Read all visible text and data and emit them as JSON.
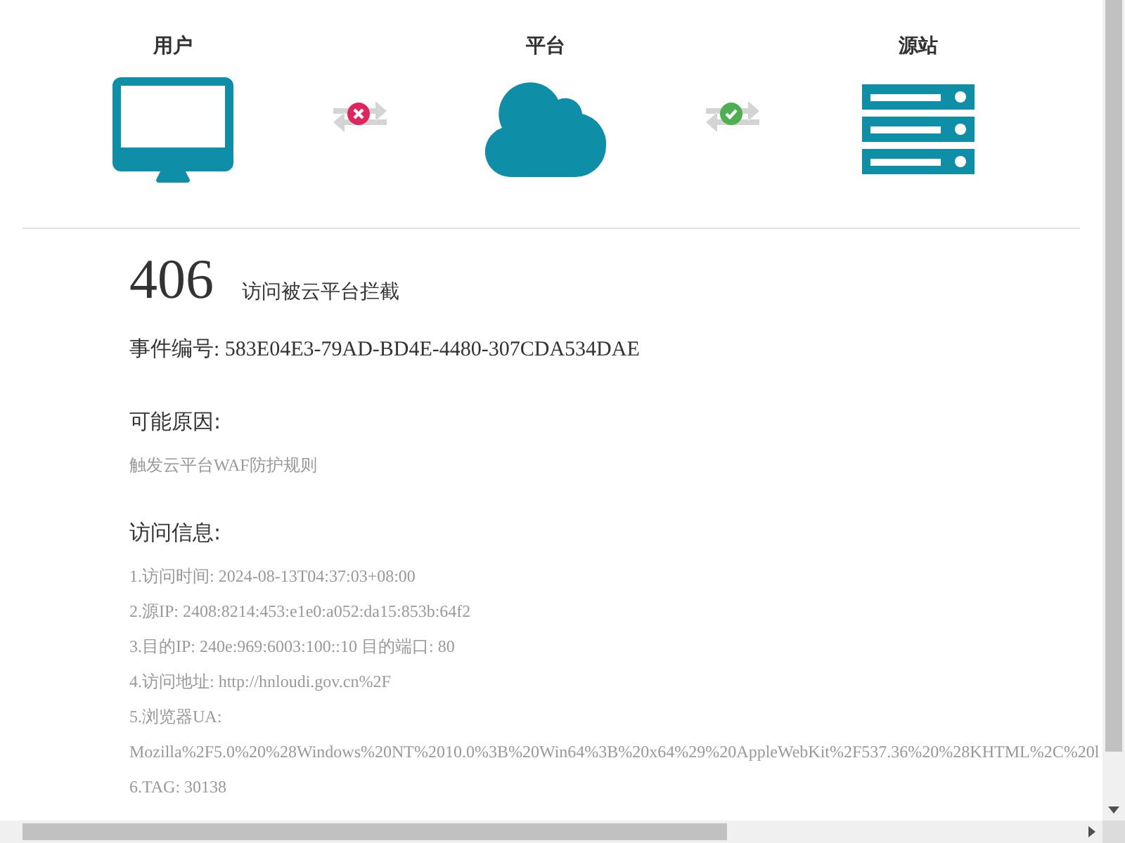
{
  "nodes": [
    {
      "label": "用户",
      "kind": "monitor"
    },
    {
      "label": "平台",
      "kind": "cloud"
    },
    {
      "label": "源站",
      "kind": "server"
    }
  ],
  "links": [
    {
      "blocked": true
    },
    {
      "blocked": false
    }
  ],
  "error": {
    "code": "406",
    "message": "访问被云平台拦截"
  },
  "event_id": "事件编号: 583E04E3-79AD-BD4E-4480-307CDA534DAE",
  "reason": {
    "heading": "可能原因:",
    "text": "触发云平台WAF防护规则"
  },
  "access_info": {
    "heading": "访问信息:",
    "lines": [
      "1.访问时间: 2024-08-13T04:37:03+08:00",
      "2.源IP: 2408:8214:453:e1e0:a052:da15:853b:64f2",
      "3.目的IP: 240e:969:6003:100::10 目的端口: 80",
      "4.访问地址: http://hnloudi.gov.cn%2F",
      "5.浏览器UA:",
      "Mozilla%2F5.0%20%28Windows%20NT%2010.0%3B%20Win64%3B%20x64%29%20AppleWebKit%2F537.36%20%28KHTML%2C%20l",
      "6.TAG: 30138"
    ]
  }
}
